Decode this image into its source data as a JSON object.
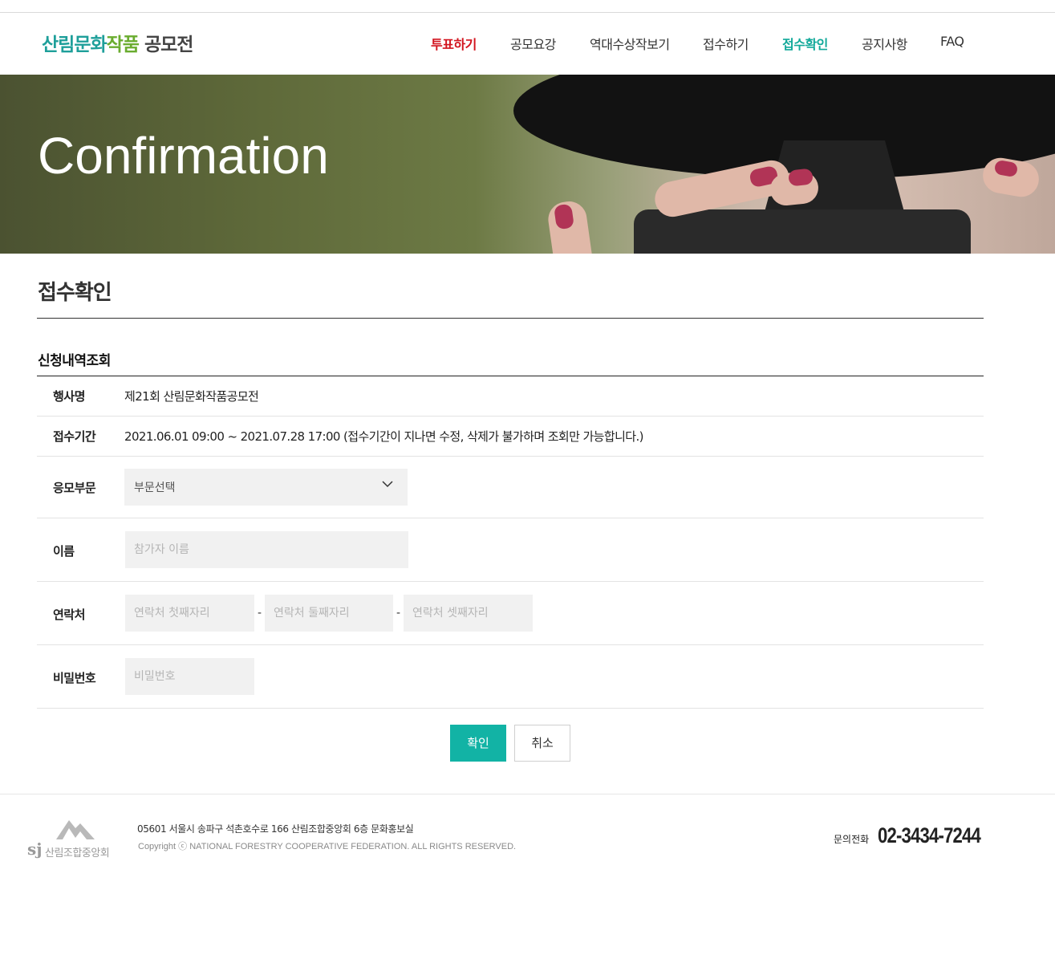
{
  "header": {
    "logo": {
      "part1": "산림문화",
      "part2": "작품",
      "part3": " 공모전"
    },
    "nav": [
      {
        "label": "투표하기"
      },
      {
        "label": "공모요강"
      },
      {
        "label": "역대수상작보기"
      },
      {
        "label": "접수하기"
      },
      {
        "label": "접수확인"
      },
      {
        "label": "공지사항"
      },
      {
        "label": "FAQ"
      }
    ],
    "active_nav": "접수확인"
  },
  "banner": {
    "title": "Confirmation"
  },
  "page": {
    "title": "접수확인",
    "section_title": "신청내역조회"
  },
  "form": {
    "event": {
      "label": "행사명",
      "value": "제21회 산림문화작품공모전"
    },
    "period": {
      "label": "접수기간",
      "value": "2021.06.01 09:00 ~ 2021.07.28 17:00 (접수기간이 지나면 수정, 삭제가 불가하며 조회만 가능합니다.)"
    },
    "category": {
      "label": "응모부문",
      "selected": "부문선택"
    },
    "name": {
      "label": "이름",
      "placeholder": "참가자 이름"
    },
    "contact": {
      "label": "연락처",
      "placeholder1": "연락처 첫째자리",
      "placeholder2": "연락처 둘째자리",
      "placeholder3": "연락처 셋째자리",
      "separator": "-"
    },
    "password": {
      "label": "비밀번호",
      "placeholder": "비밀번호"
    },
    "confirm_label": "확인",
    "cancel_label": "취소"
  },
  "footer": {
    "logo_mark": "sj",
    "logo_org": "산림조합중앙회",
    "address": "05601 서울시 송파구 석촌호수로 166 산림조합중앙회 6층 문화홍보실",
    "copyright": "Copyright ⓒ NATIONAL FORESTRY COOPERATIVE FEDERATION. ALL RIGHTS RESERVED.",
    "phone_label": "문의전화",
    "phone": "02-3434-7244"
  },
  "colors": {
    "accent": "#12b3a5",
    "vote": "#d2141e",
    "logo_teal": "#1e9f9a",
    "logo_green": "#6aac2f"
  }
}
